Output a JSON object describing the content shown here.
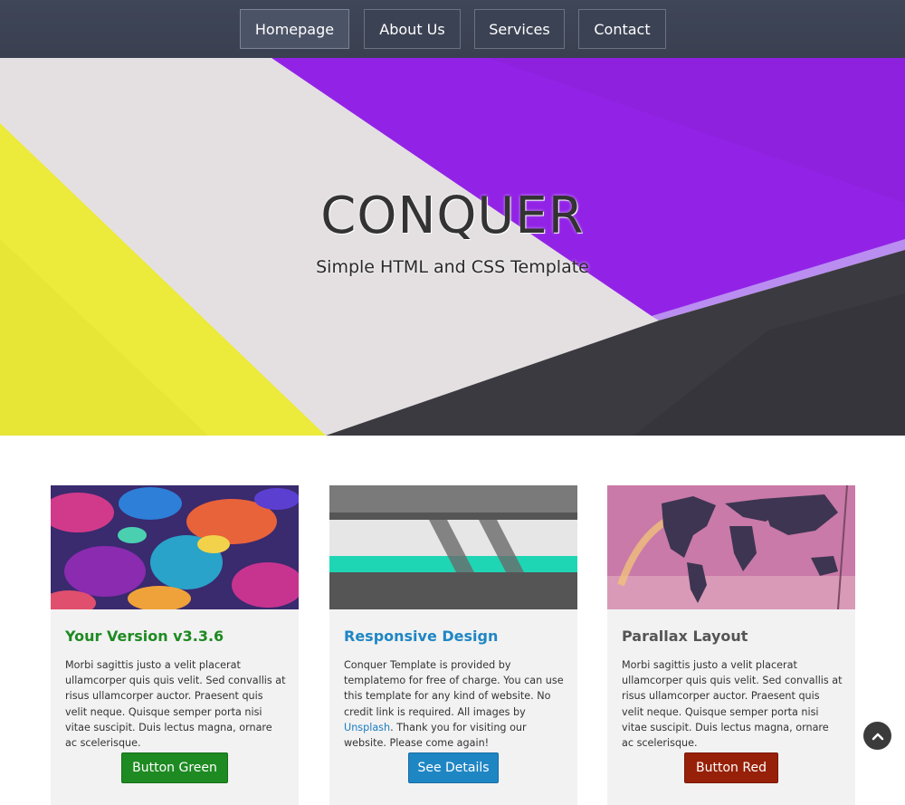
{
  "nav": {
    "items": [
      {
        "label": "Homepage",
        "active": true
      },
      {
        "label": "About Us",
        "active": false
      },
      {
        "label": "Services",
        "active": false
      },
      {
        "label": "Contact",
        "active": false
      }
    ]
  },
  "hero": {
    "title": "CONQUER",
    "subtitle": "Simple HTML and CSS Template"
  },
  "cards": [
    {
      "title": "Your Version v3.3.6",
      "title_color": "#1e8a22",
      "body": "Morbi sagittis justo a velit placerat ullamcorper quis quis velit. Sed convallis at risus ullamcorper auctor. Praesent quis velit neque. Quisque semper porta nisi vitae suscipit. Duis lectus magna, ornare ac scelerisque.",
      "button": "Button Green",
      "button_color": "#1e8a22"
    },
    {
      "title": "Responsive Design",
      "title_color": "#1f86c4",
      "body_before_link": "Conquer Template is provided by templatemo for free of charge. You can use this template for any kind of website. No credit link is required. All images by ",
      "link": "Unsplash",
      "body_after_link": ". Thank you for visiting our website. Please come again!",
      "button": "See Details",
      "button_color": "#1f86c4"
    },
    {
      "title": "Parallax Layout",
      "title_color": "#555555",
      "body": "Morbi sagittis justo a velit placerat ullamcorper quis quis velit. Sed convallis at risus ullamcorper auctor. Praesent quis velit neque. Quisque semper porta nisi vitae suscipit. Duis lectus magna, ornare ac scelerisque.",
      "button": "Button Red",
      "button_color": "#962108"
    }
  ],
  "icons": {
    "back_to_top": "chevron-up-icon"
  }
}
